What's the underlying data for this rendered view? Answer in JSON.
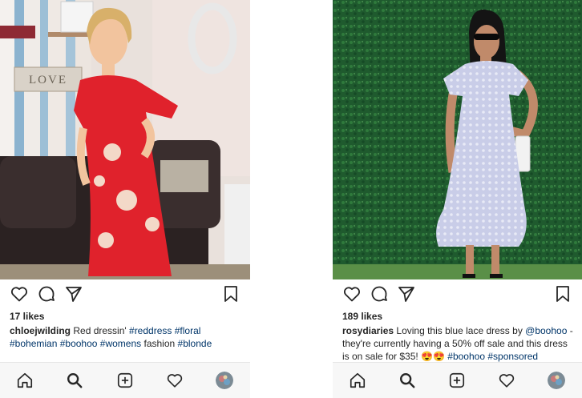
{
  "colors": {
    "text": "#262626",
    "hashtag": "#003569",
    "nav_background": "#f7f7f7",
    "dress_red": "#e0222c",
    "dress_lace": "#c9cde8",
    "hedge_green": "#1f5a2e"
  },
  "posts": [
    {
      "image_description": "woman in red floral dress in living room",
      "sign_text": "LOVE",
      "likes": "17 likes",
      "caption": {
        "username": "chloejwilding",
        "text": "Red dressin' ",
        "hashtags": [
          "#reddress",
          "#floral",
          "#bohemian",
          "#boohoo",
          "#womens"
        ],
        "middle_text": "fashion",
        "last_tag": "#blonde"
      },
      "icons": [
        "heart-icon",
        "comment-icon",
        "share-icon",
        "bookmark-icon"
      ],
      "nav": [
        "home-icon",
        "search-icon",
        "add-post-icon",
        "activity-heart-icon",
        "profile-avatar"
      ]
    },
    {
      "image_description": "woman in blue lace dress in front of green hedge",
      "likes": "189 likes",
      "caption": {
        "username": "rosydiaries",
        "line1": "Loving this blue lace dress by ",
        "mention": "@boohoo",
        "line1_end": " -",
        "line2": "they're currently having a 50% off sale and this dress",
        "line3": "is on sale for $35! 😍😍 ",
        "hashtags": [
          "#boohoo",
          "#sponsored"
        ]
      },
      "icons": [
        "heart-icon",
        "comment-icon",
        "share-icon",
        "bookmark-icon"
      ],
      "nav": [
        "home-icon",
        "search-icon",
        "add-post-icon",
        "activity-heart-icon",
        "profile-avatar"
      ]
    }
  ]
}
